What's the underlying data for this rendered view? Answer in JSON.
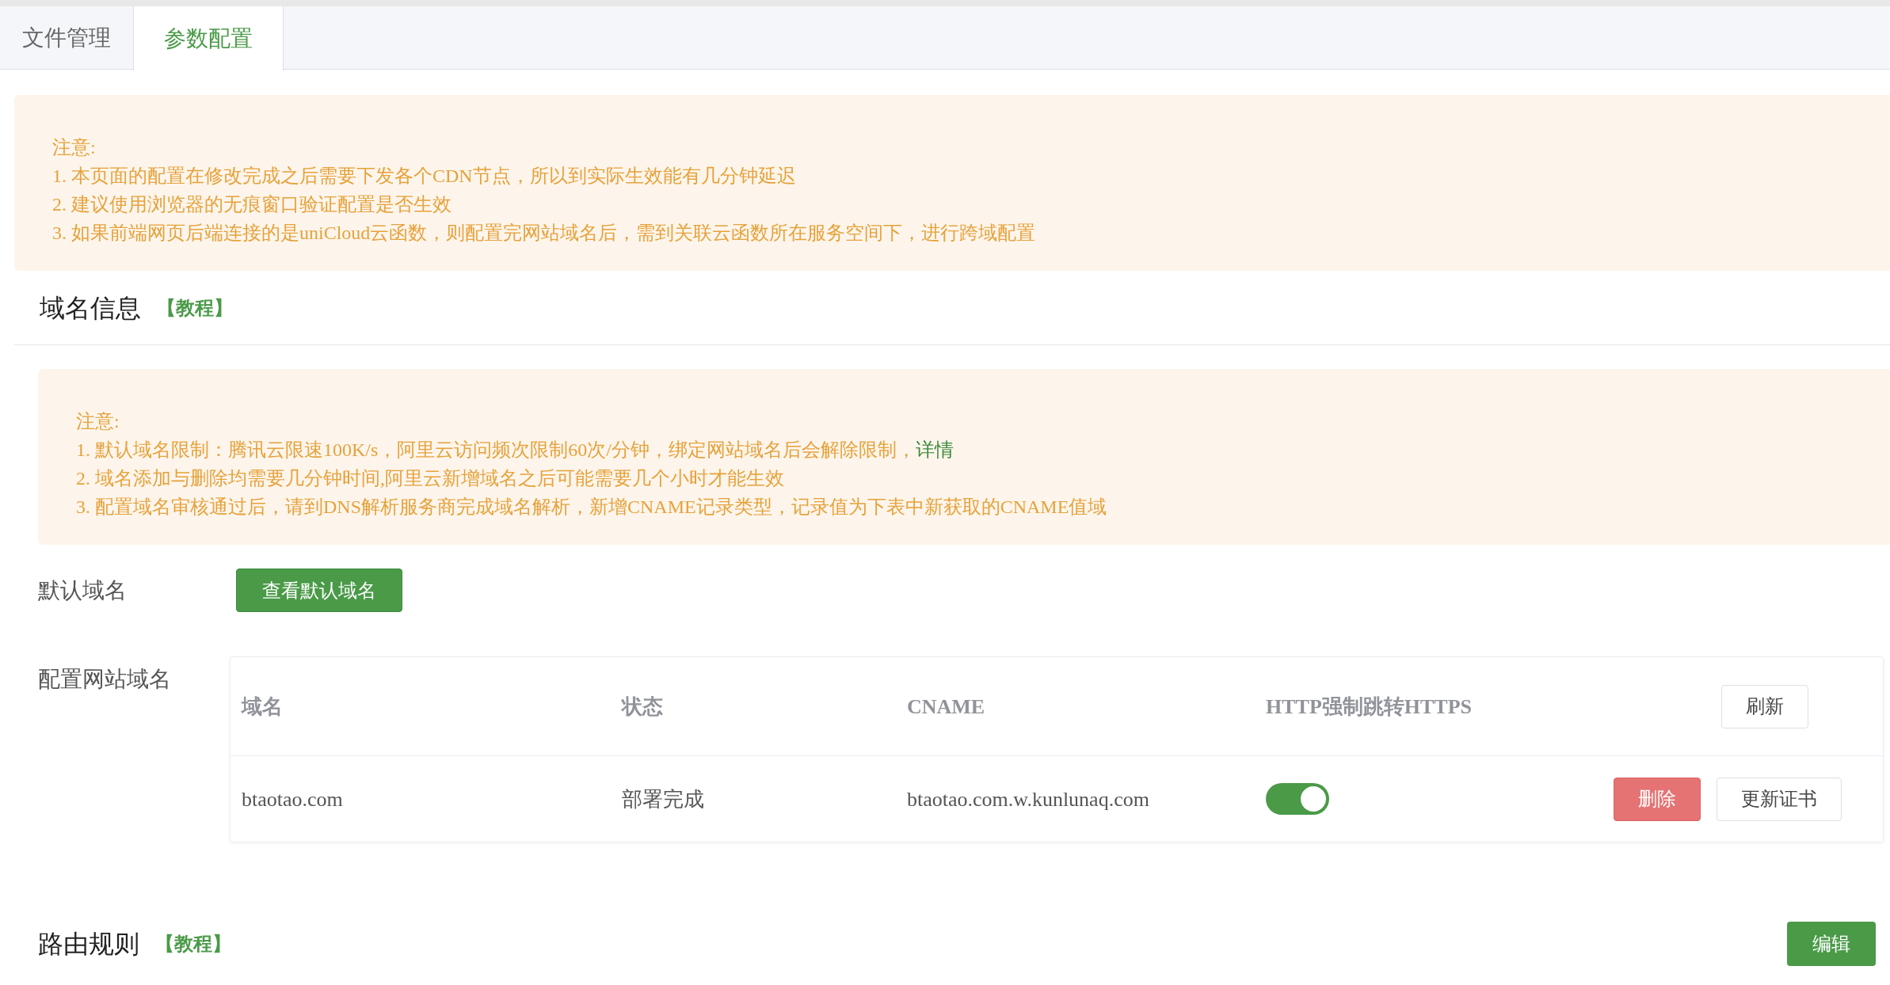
{
  "tabs": [
    {
      "label": "文件管理",
      "selected": false
    },
    {
      "label": "参数配置",
      "selected": true
    }
  ],
  "top_notice": {
    "title": "注意:",
    "lines": [
      "1. 本页面的配置在修改完成之后需要下发各个CDN节点，所以到实际生效能有几分钟延迟",
      "2. 建议使用浏览器的无痕窗口验证配置是否生效",
      "3. 如果前端网页后端连接的是uniCloud云函数，则配置完网站域名后，需到关联云函数所在服务空间下，进行跨域配置"
    ]
  },
  "domain_section": {
    "title": "域名信息",
    "tutorial_link": "【教程】",
    "notice": {
      "title": "注意:",
      "lines": [
        {
          "text": "1. 默认域名限制：腾讯云限速100K/s，阿里云访问频次限制60次/分钟，绑定网站域名后会解除限制，",
          "link": "详情"
        },
        {
          "text": "2. 域名添加与删除均需要几分钟时间,阿里云新增域名之后可能需要几个小时才能生效"
        },
        {
          "text": "3. 配置域名审核通过后，请到DNS解析服务商完成域名解析，新增CNAME记录类型，记录值为下表中新获取的CNAME值域"
        }
      ]
    },
    "default_domain": {
      "label": "默认域名",
      "button": "查看默认域名"
    },
    "site_domains": {
      "label": "配置网站域名",
      "columns": [
        "域名",
        "状态",
        "CNAME",
        "HTTP强制跳转HTTPS"
      ],
      "refresh_button": "刷新",
      "rows": [
        {
          "domain": "btaotao.com",
          "status": "部署完成",
          "cname": "btaotao.com.w.kunlunaq.com",
          "force_https": true,
          "delete_button": "删除",
          "renew_button": "更新证书"
        }
      ]
    }
  },
  "route_section": {
    "title": "路由规则",
    "tutorial_link": "【教程】",
    "edit_button": "编辑"
  }
}
